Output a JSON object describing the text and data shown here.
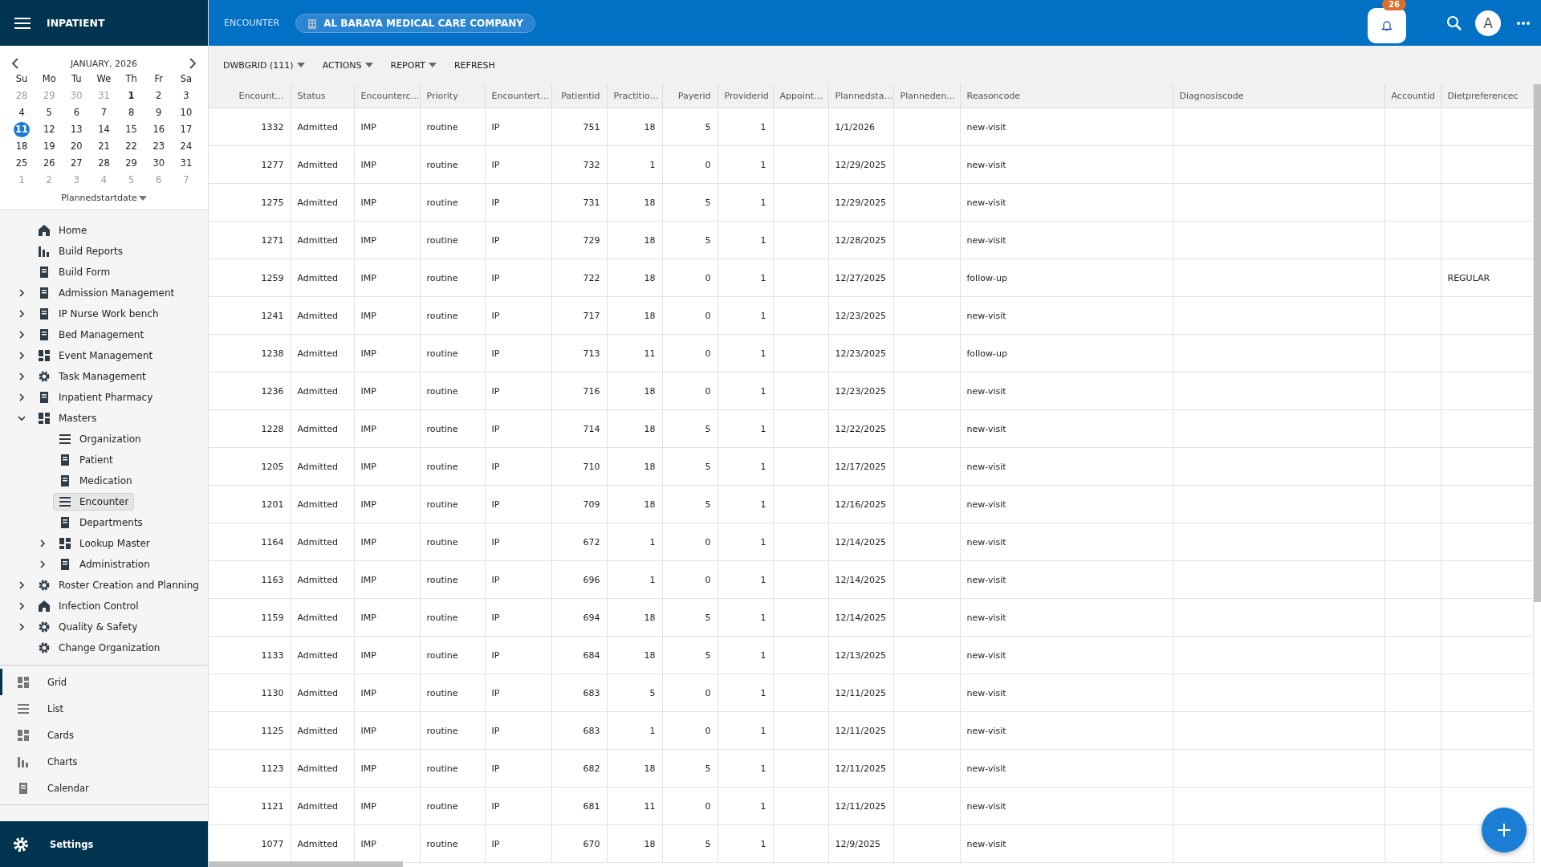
{
  "app": {
    "title": "INPATIENT"
  },
  "calendar": {
    "month": "JANUARY, 2026",
    "weekdays": [
      "Su",
      "Mo",
      "Tu",
      "We",
      "Th",
      "Fr",
      "Sa"
    ],
    "field": "Plannedstartdate",
    "weeks": [
      [
        {
          "d": "28",
          "outside": true,
          "today": false,
          "selected": false
        },
        {
          "d": "29",
          "outside": true,
          "today": false,
          "selected": false
        },
        {
          "d": "30",
          "outside": true,
          "today": false,
          "selected": false
        },
        {
          "d": "31",
          "outside": true,
          "today": false,
          "selected": false
        },
        {
          "d": "1",
          "outside": false,
          "today": true,
          "selected": false
        },
        {
          "d": "2",
          "outside": false,
          "today": false,
          "selected": false
        },
        {
          "d": "3",
          "outside": false,
          "today": false,
          "selected": false
        }
      ],
      [
        {
          "d": "4",
          "outside": false,
          "today": false,
          "selected": false
        },
        {
          "d": "5",
          "outside": false,
          "today": false,
          "selected": false
        },
        {
          "d": "6",
          "outside": false,
          "today": false,
          "selected": false
        },
        {
          "d": "7",
          "outside": false,
          "today": false,
          "selected": false
        },
        {
          "d": "8",
          "outside": false,
          "today": false,
          "selected": false
        },
        {
          "d": "9",
          "outside": false,
          "today": false,
          "selected": false
        },
        {
          "d": "10",
          "outside": false,
          "today": false,
          "selected": false
        }
      ],
      [
        {
          "d": "11",
          "outside": false,
          "today": false,
          "selected": true
        },
        {
          "d": "12",
          "outside": false,
          "today": false,
          "selected": false
        },
        {
          "d": "13",
          "outside": false,
          "today": false,
          "selected": false
        },
        {
          "d": "14",
          "outside": false,
          "today": false,
          "selected": false
        },
        {
          "d": "15",
          "outside": false,
          "today": false,
          "selected": false
        },
        {
          "d": "16",
          "outside": false,
          "today": false,
          "selected": false
        },
        {
          "d": "17",
          "outside": false,
          "today": false,
          "selected": false
        }
      ],
      [
        {
          "d": "18",
          "outside": false,
          "today": false,
          "selected": false
        },
        {
          "d": "19",
          "outside": false,
          "today": false,
          "selected": false
        },
        {
          "d": "20",
          "outside": false,
          "today": false,
          "selected": false
        },
        {
          "d": "21",
          "outside": false,
          "today": false,
          "selected": false
        },
        {
          "d": "22",
          "outside": false,
          "today": false,
          "selected": false
        },
        {
          "d": "23",
          "outside": false,
          "today": false,
          "selected": false
        },
        {
          "d": "24",
          "outside": false,
          "today": false,
          "selected": false
        }
      ],
      [
        {
          "d": "25",
          "outside": false,
          "today": false,
          "selected": false
        },
        {
          "d": "26",
          "outside": false,
          "today": false,
          "selected": false
        },
        {
          "d": "27",
          "outside": false,
          "today": false,
          "selected": false
        },
        {
          "d": "28",
          "outside": false,
          "today": false,
          "selected": false
        },
        {
          "d": "29",
          "outside": false,
          "today": false,
          "selected": false
        },
        {
          "d": "30",
          "outside": false,
          "today": false,
          "selected": false
        },
        {
          "d": "31",
          "outside": false,
          "today": false,
          "selected": false
        }
      ],
      [
        {
          "d": "1",
          "outside": true,
          "today": false,
          "selected": false
        },
        {
          "d": "2",
          "outside": true,
          "today": false,
          "selected": false
        },
        {
          "d": "3",
          "outside": true,
          "today": false,
          "selected": false
        },
        {
          "d": "4",
          "outside": true,
          "today": false,
          "selected": false
        },
        {
          "d": "5",
          "outside": true,
          "today": false,
          "selected": false
        },
        {
          "d": "6",
          "outside": true,
          "today": false,
          "selected": false
        },
        {
          "d": "7",
          "outside": true,
          "today": false,
          "selected": false
        }
      ]
    ]
  },
  "nav": [
    {
      "label": "Home",
      "selected": false
    },
    {
      "label": "Build Reports",
      "selected": false
    },
    {
      "label": "Build Form",
      "selected": false
    },
    {
      "label": "Admission Management",
      "selected": false,
      "expanded": false
    },
    {
      "label": "IP Nurse Work bench",
      "selected": false,
      "expanded": false
    },
    {
      "label": "Bed Management",
      "selected": false,
      "expanded": false
    },
    {
      "label": "Event Management",
      "selected": false,
      "expanded": false
    },
    {
      "label": "Task Management",
      "selected": false,
      "expanded": false
    },
    {
      "label": "Inpatient Pharmacy",
      "selected": false,
      "expanded": false
    },
    {
      "label": "Masters",
      "selected": false,
      "expanded": true,
      "children": [
        {
          "label": "Organization",
          "selected": false
        },
        {
          "label": "Patient",
          "selected": false
        },
        {
          "label": "Medication",
          "selected": false
        },
        {
          "label": "Encounter",
          "selected": true
        },
        {
          "label": "Departments",
          "selected": false
        },
        {
          "label": "Lookup Master",
          "selected": false,
          "expanded": false
        },
        {
          "label": "Administration",
          "selected": false,
          "expanded": false
        }
      ]
    },
    {
      "label": "Roster Creation and Planning",
      "selected": false,
      "expanded": false
    },
    {
      "label": "Infection Control",
      "selected": false,
      "expanded": false
    },
    {
      "label": "Quality & Safety",
      "selected": false,
      "expanded": false
    },
    {
      "label": "Change Organization",
      "selected": false
    }
  ],
  "views": [
    {
      "label": "Grid",
      "selected": true
    },
    {
      "label": "List",
      "selected": false
    },
    {
      "label": "Cards",
      "selected": false
    },
    {
      "label": "Charts",
      "selected": false
    },
    {
      "label": "Calendar",
      "selected": false
    }
  ],
  "settings": {
    "label": "Settings"
  },
  "header": {
    "page": "ENCOUNTER",
    "company": "AL BARAYA MEDICAL CARE COMPANY",
    "notifications": "26",
    "avatar": "A"
  },
  "toolbar": [
    {
      "label": "DWBGRID (111)",
      "dropdown": true
    },
    {
      "label": "ACTIONS",
      "dropdown": true
    },
    {
      "label": "REPORT",
      "dropdown": true
    },
    {
      "label": "REFRESH",
      "dropdown": false
    }
  ],
  "table": {
    "columns": [
      {
        "label": "Encount…",
        "kind": "number"
      },
      {
        "label": "Status",
        "kind": "text"
      },
      {
        "label": "Encounterc…",
        "kind": "text"
      },
      {
        "label": "Priority",
        "kind": "text"
      },
      {
        "label": "Encountert…",
        "kind": "text"
      },
      {
        "label": "Patientid",
        "kind": "number"
      },
      {
        "label": "Practitio…",
        "kind": "number"
      },
      {
        "label": "Payerid",
        "kind": "number"
      },
      {
        "label": "Providerid",
        "kind": "number"
      },
      {
        "label": "Appoint…",
        "kind": "text"
      },
      {
        "label": "Plannedsta…",
        "kind": "text"
      },
      {
        "label": "Planneden…",
        "kind": "text"
      },
      {
        "label": "Reasoncode",
        "kind": "text"
      },
      {
        "label": "Diagnosiscode",
        "kind": "text"
      },
      {
        "label": "Accountid",
        "kind": "number"
      },
      {
        "label": "Dietpreferencec",
        "kind": "text"
      }
    ],
    "rows": [
      [
        "1332",
        "Admitted",
        "IMP",
        "routine",
        "IP",
        "751",
        "18",
        "5",
        "1",
        null,
        "1/1/2026",
        null,
        "new-visit",
        null,
        null,
        null
      ],
      [
        "1277",
        "Admitted",
        "IMP",
        "routine",
        "IP",
        "732",
        "1",
        "0",
        "1",
        null,
        "12/29/2025",
        null,
        "new-visit",
        null,
        null,
        null
      ],
      [
        "1275",
        "Admitted",
        "IMP",
        "routine",
        "IP",
        "731",
        "18",
        "5",
        "1",
        null,
        "12/29/2025",
        null,
        "new-visit",
        null,
        null,
        null
      ],
      [
        "1271",
        "Admitted",
        "IMP",
        "routine",
        "IP",
        "729",
        "18",
        "5",
        "1",
        null,
        "12/28/2025",
        null,
        "new-visit",
        null,
        null,
        null
      ],
      [
        "1259",
        "Admitted",
        "IMP",
        "routine",
        "IP",
        "722",
        "18",
        "0",
        "1",
        null,
        "12/27/2025",
        null,
        "follow-up",
        null,
        null,
        "REGULAR"
      ],
      [
        "1241",
        "Admitted",
        "IMP",
        "routine",
        "IP",
        "717",
        "18",
        "0",
        "1",
        null,
        "12/23/2025",
        null,
        "new-visit",
        null,
        null,
        null
      ],
      [
        "1238",
        "Admitted",
        "IMP",
        "routine",
        "IP",
        "713",
        "11",
        "0",
        "1",
        null,
        "12/23/2025",
        null,
        "follow-up",
        null,
        null,
        null
      ],
      [
        "1236",
        "Admitted",
        "IMP",
        "routine",
        "IP",
        "716",
        "18",
        "0",
        "1",
        null,
        "12/23/2025",
        null,
        "new-visit",
        null,
        null,
        null
      ],
      [
        "1228",
        "Admitted",
        "IMP",
        "routine",
        "IP",
        "714",
        "18",
        "5",
        "1",
        null,
        "12/22/2025",
        null,
        "new-visit",
        null,
        null,
        null
      ],
      [
        "1205",
        "Admitted",
        "IMP",
        "routine",
        "IP",
        "710",
        "18",
        "5",
        "1",
        null,
        "12/17/2025",
        null,
        "new-visit",
        null,
        null,
        null
      ],
      [
        "1201",
        "Admitted",
        "IMP",
        "routine",
        "IP",
        "709",
        "18",
        "5",
        "1",
        null,
        "12/16/2025",
        null,
        "new-visit",
        null,
        null,
        null
      ],
      [
        "1164",
        "Admitted",
        "IMP",
        "routine",
        "IP",
        "672",
        "1",
        "0",
        "1",
        null,
        "12/14/2025",
        null,
        "new-visit",
        null,
        null,
        null
      ],
      [
        "1163",
        "Admitted",
        "IMP",
        "routine",
        "IP",
        "696",
        "1",
        "0",
        "1",
        null,
        "12/14/2025",
        null,
        "new-visit",
        null,
        null,
        null
      ],
      [
        "1159",
        "Admitted",
        "IMP",
        "routine",
        "IP",
        "694",
        "18",
        "5",
        "1",
        null,
        "12/14/2025",
        null,
        "new-visit",
        null,
        null,
        null
      ],
      [
        "1133",
        "Admitted",
        "IMP",
        "routine",
        "IP",
        "684",
        "18",
        "5",
        "1",
        null,
        "12/13/2025",
        null,
        "new-visit",
        null,
        null,
        null
      ],
      [
        "1130",
        "Admitted",
        "IMP",
        "routine",
        "IP",
        "683",
        "5",
        "0",
        "1",
        null,
        "12/11/2025",
        null,
        "new-visit",
        null,
        null,
        null
      ],
      [
        "1125",
        "Admitted",
        "IMP",
        "routine",
        "IP",
        "683",
        "1",
        "0",
        "1",
        null,
        "12/11/2025",
        null,
        "new-visit",
        null,
        null,
        null
      ],
      [
        "1123",
        "Admitted",
        "IMP",
        "routine",
        "IP",
        "682",
        "18",
        "5",
        "1",
        null,
        "12/11/2025",
        null,
        "new-visit",
        null,
        null,
        null
      ],
      [
        "1121",
        "Admitted",
        "IMP",
        "routine",
        "IP",
        "681",
        "11",
        "0",
        "1",
        null,
        "12/11/2025",
        null,
        "new-visit",
        null,
        null,
        null
      ],
      [
        "1077",
        "Admitted",
        "IMP",
        "routine",
        "IP",
        "670",
        "18",
        "5",
        "1",
        null,
        "12/9/2025",
        null,
        "new-visit",
        null,
        null,
        null
      ]
    ]
  }
}
